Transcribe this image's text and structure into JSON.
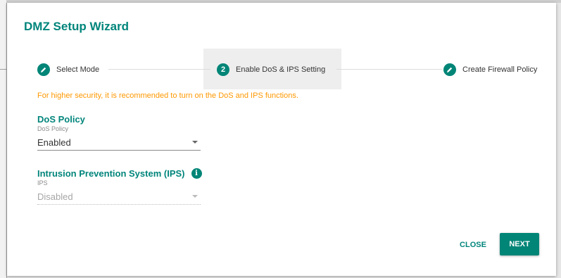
{
  "dialog": {
    "title": "DMZ Setup Wizard"
  },
  "stepper": {
    "steps": [
      {
        "label": "Select Mode",
        "marker": "",
        "icon": "pencil-icon"
      },
      {
        "label": "Enable DoS & IPS Setting",
        "marker": "2",
        "icon": ""
      },
      {
        "label": "Create Firewall Policy",
        "marker": "",
        "icon": "pencil-icon"
      }
    ],
    "active_index": 1
  },
  "notice": "For higher security, it is recommended to turn on the DoS and IPS functions.",
  "dos": {
    "heading": "DoS Policy",
    "caption": "DoS Policy",
    "value": "Enabled"
  },
  "ips": {
    "heading": "Intrusion Prevention System (IPS)",
    "info_icon": "i",
    "caption": "IPS",
    "value": "Disabled"
  },
  "actions": {
    "close_label": "CLOSE",
    "next_label": "NEXT"
  },
  "colors": {
    "accent": "#00857b",
    "warning": "#ff9800"
  }
}
